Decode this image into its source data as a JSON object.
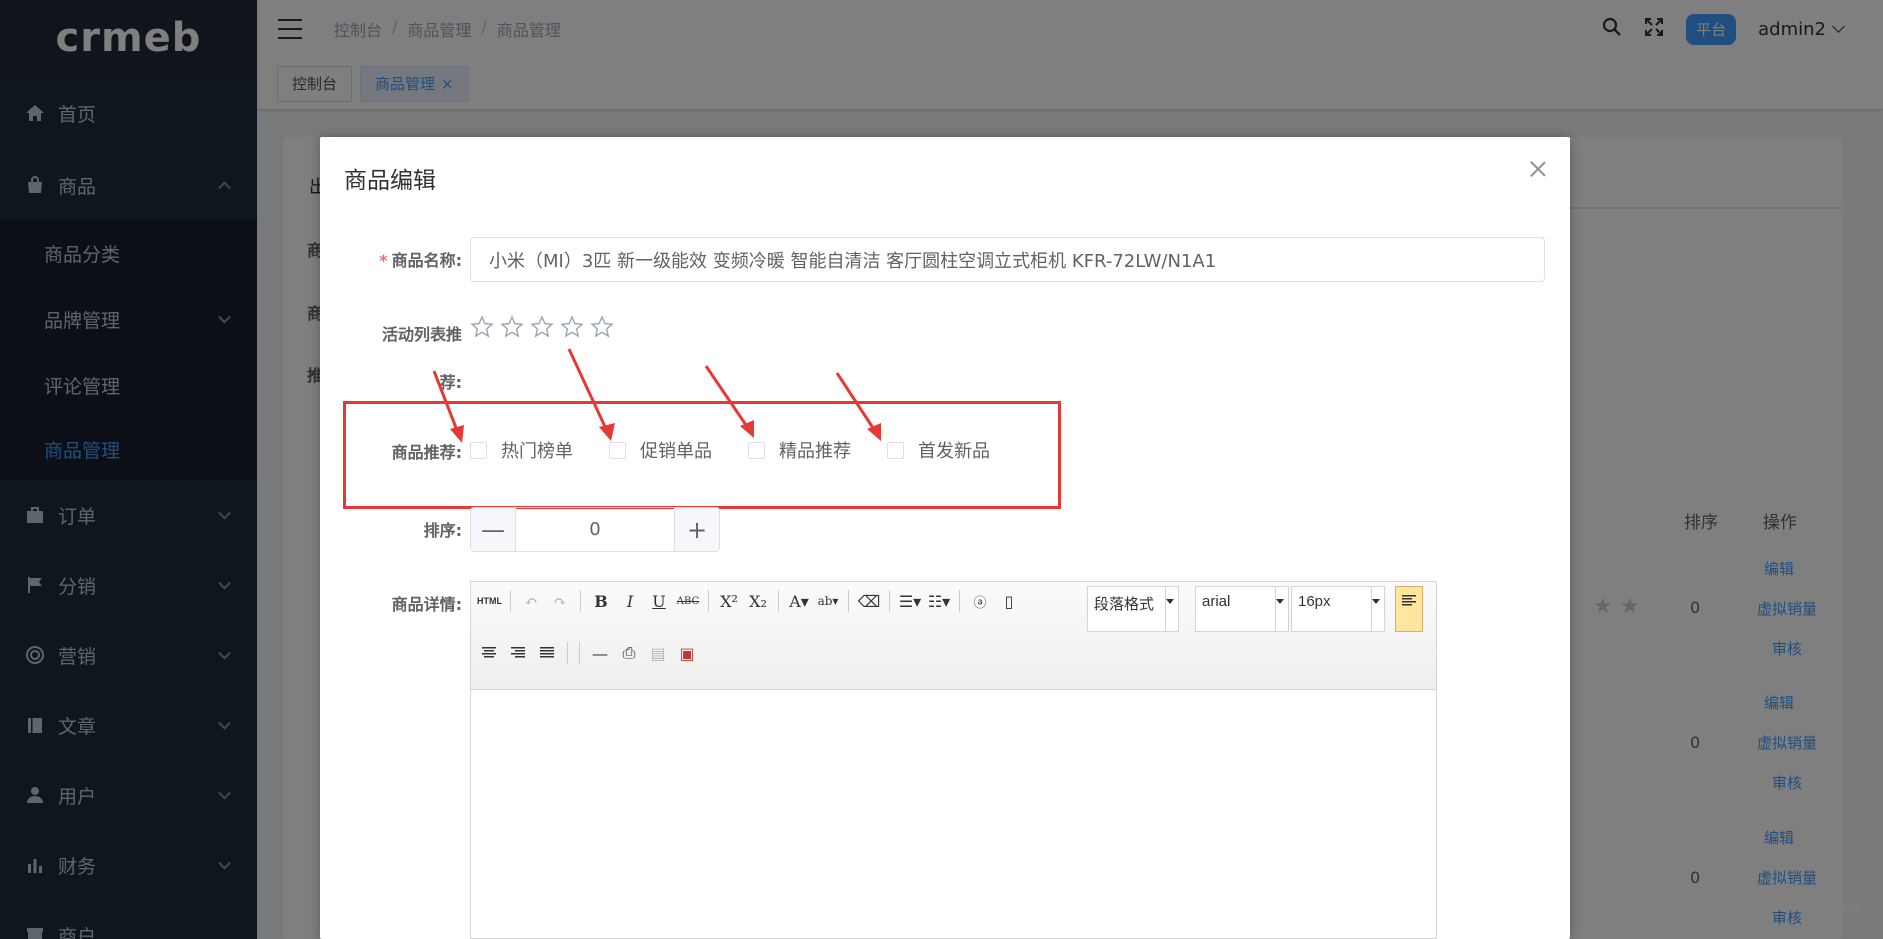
{
  "sidebar": {
    "logo": "crmeb",
    "items": [
      {
        "label": "首页",
        "icon": "home-icon"
      },
      {
        "label": "商品",
        "icon": "shopping-bag-icon",
        "expanded": true
      },
      {
        "label": "订单",
        "icon": "briefcase-icon"
      },
      {
        "label": "分销",
        "icon": "flag-icon"
      },
      {
        "label": "营销",
        "icon": "target-icon"
      },
      {
        "label": "文章",
        "icon": "book-icon"
      },
      {
        "label": "用户",
        "icon": "user-icon"
      },
      {
        "label": "财务",
        "icon": "bar-chart-icon"
      },
      {
        "label": "商户",
        "icon": "store-icon"
      }
    ],
    "submenu": [
      {
        "label": "商品分类"
      },
      {
        "label": "品牌管理"
      },
      {
        "label": "评论管理"
      },
      {
        "label": "商品管理",
        "active": true
      }
    ]
  },
  "header": {
    "breadcrumb": [
      "控制台",
      "商品管理",
      "商品管理"
    ],
    "role_badge": "平台",
    "username": "admin2"
  },
  "tags": [
    {
      "label": "控制台",
      "active": false
    },
    {
      "label": "商品管理",
      "active": true,
      "close": "×"
    }
  ],
  "background_table": {
    "tab_fragment": "出",
    "label_fragments": [
      "商",
      "商",
      "推"
    ],
    "columns": [
      "排序",
      "操作"
    ],
    "rows": [
      {
        "sort": "0",
        "actions": [
          "编辑",
          "虚拟销量",
          "审核"
        ]
      },
      {
        "sort": "0",
        "actions": [
          "编辑",
          "虚拟销量",
          "审核"
        ]
      },
      {
        "sort": "0",
        "actions": [
          "编辑",
          "虚拟销量",
          "审核"
        ]
      }
    ]
  },
  "dialog": {
    "title": "商品编辑",
    "name_label": "商品名称:",
    "name_required": "*",
    "name_value": "小米（MI）3匹 新一级能效 变频冷暖  智能自清洁 客厅圆柱空调立式柜机 KFR-72LW/N1A1",
    "activity_label_line1": "活动列表推",
    "activity_label_line2": "荐:",
    "activity_stars": 0,
    "recommend_label": "商品推荐:",
    "recommend_options": [
      "热门榜单",
      "促销单品",
      "精品推荐",
      "首发新品"
    ],
    "sort_label": "排序:",
    "sort_value": "0",
    "sort_minus": "—",
    "sort_plus": "+",
    "detail_label": "商品详情:",
    "editor": {
      "html_btn": "HTML",
      "paragraph_select": "段落格式",
      "font_select": "arial",
      "size_select": "16px"
    }
  },
  "colors": {
    "sidebar_bg": "#1f2d3d",
    "accent": "#409eff",
    "annotation_red": "#e53935"
  }
}
